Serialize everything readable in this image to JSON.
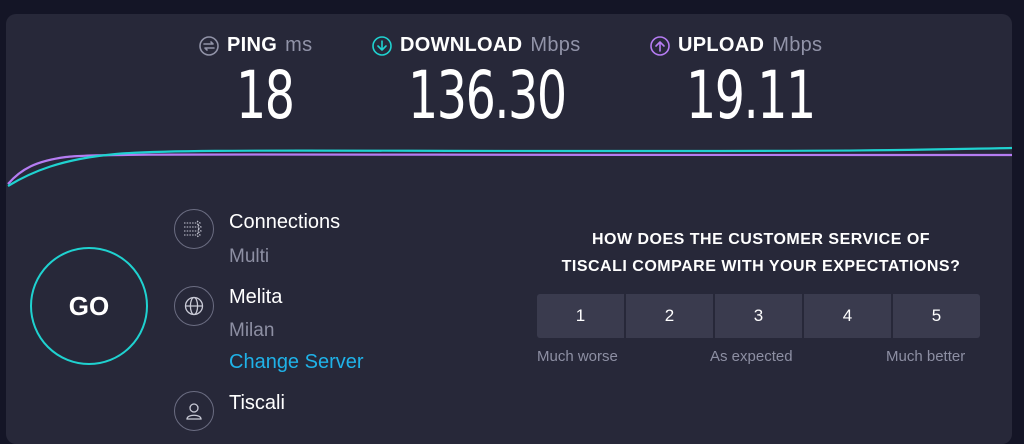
{
  "metrics": {
    "ping": {
      "label": "PING",
      "unit": "ms",
      "value": "18",
      "color": "#9193a8",
      "icon": "ping-icon"
    },
    "download": {
      "label": "DOWNLOAD",
      "unit": "Mbps",
      "value": "136.30",
      "color": "#1fd2d0",
      "icon": "download-arrow-icon"
    },
    "upload": {
      "label": "UPLOAD",
      "unit": "Mbps",
      "value": "19.11",
      "color": "#b57cf2",
      "icon": "upload-arrow-icon"
    }
  },
  "go_button": {
    "label": "GO",
    "color": "#1fd2d0"
  },
  "connections": {
    "title": "Connections",
    "value": "Multi",
    "icon": "connections-icon"
  },
  "server": {
    "title": "Melita",
    "location": "Milan",
    "change_label": "Change Server",
    "icon": "globe-icon"
  },
  "provider": {
    "title": "Tiscali",
    "icon": "user-icon"
  },
  "survey": {
    "question_line1": "HOW DOES THE CUSTOMER SERVICE OF",
    "question_line2": "TISCALI COMPARE WITH YOUR EXPECTATIONS?",
    "options": [
      "1",
      "2",
      "3",
      "4",
      "5"
    ],
    "scale_low": "Much worse",
    "scale_mid": "As expected",
    "scale_high": "Much better"
  }
}
